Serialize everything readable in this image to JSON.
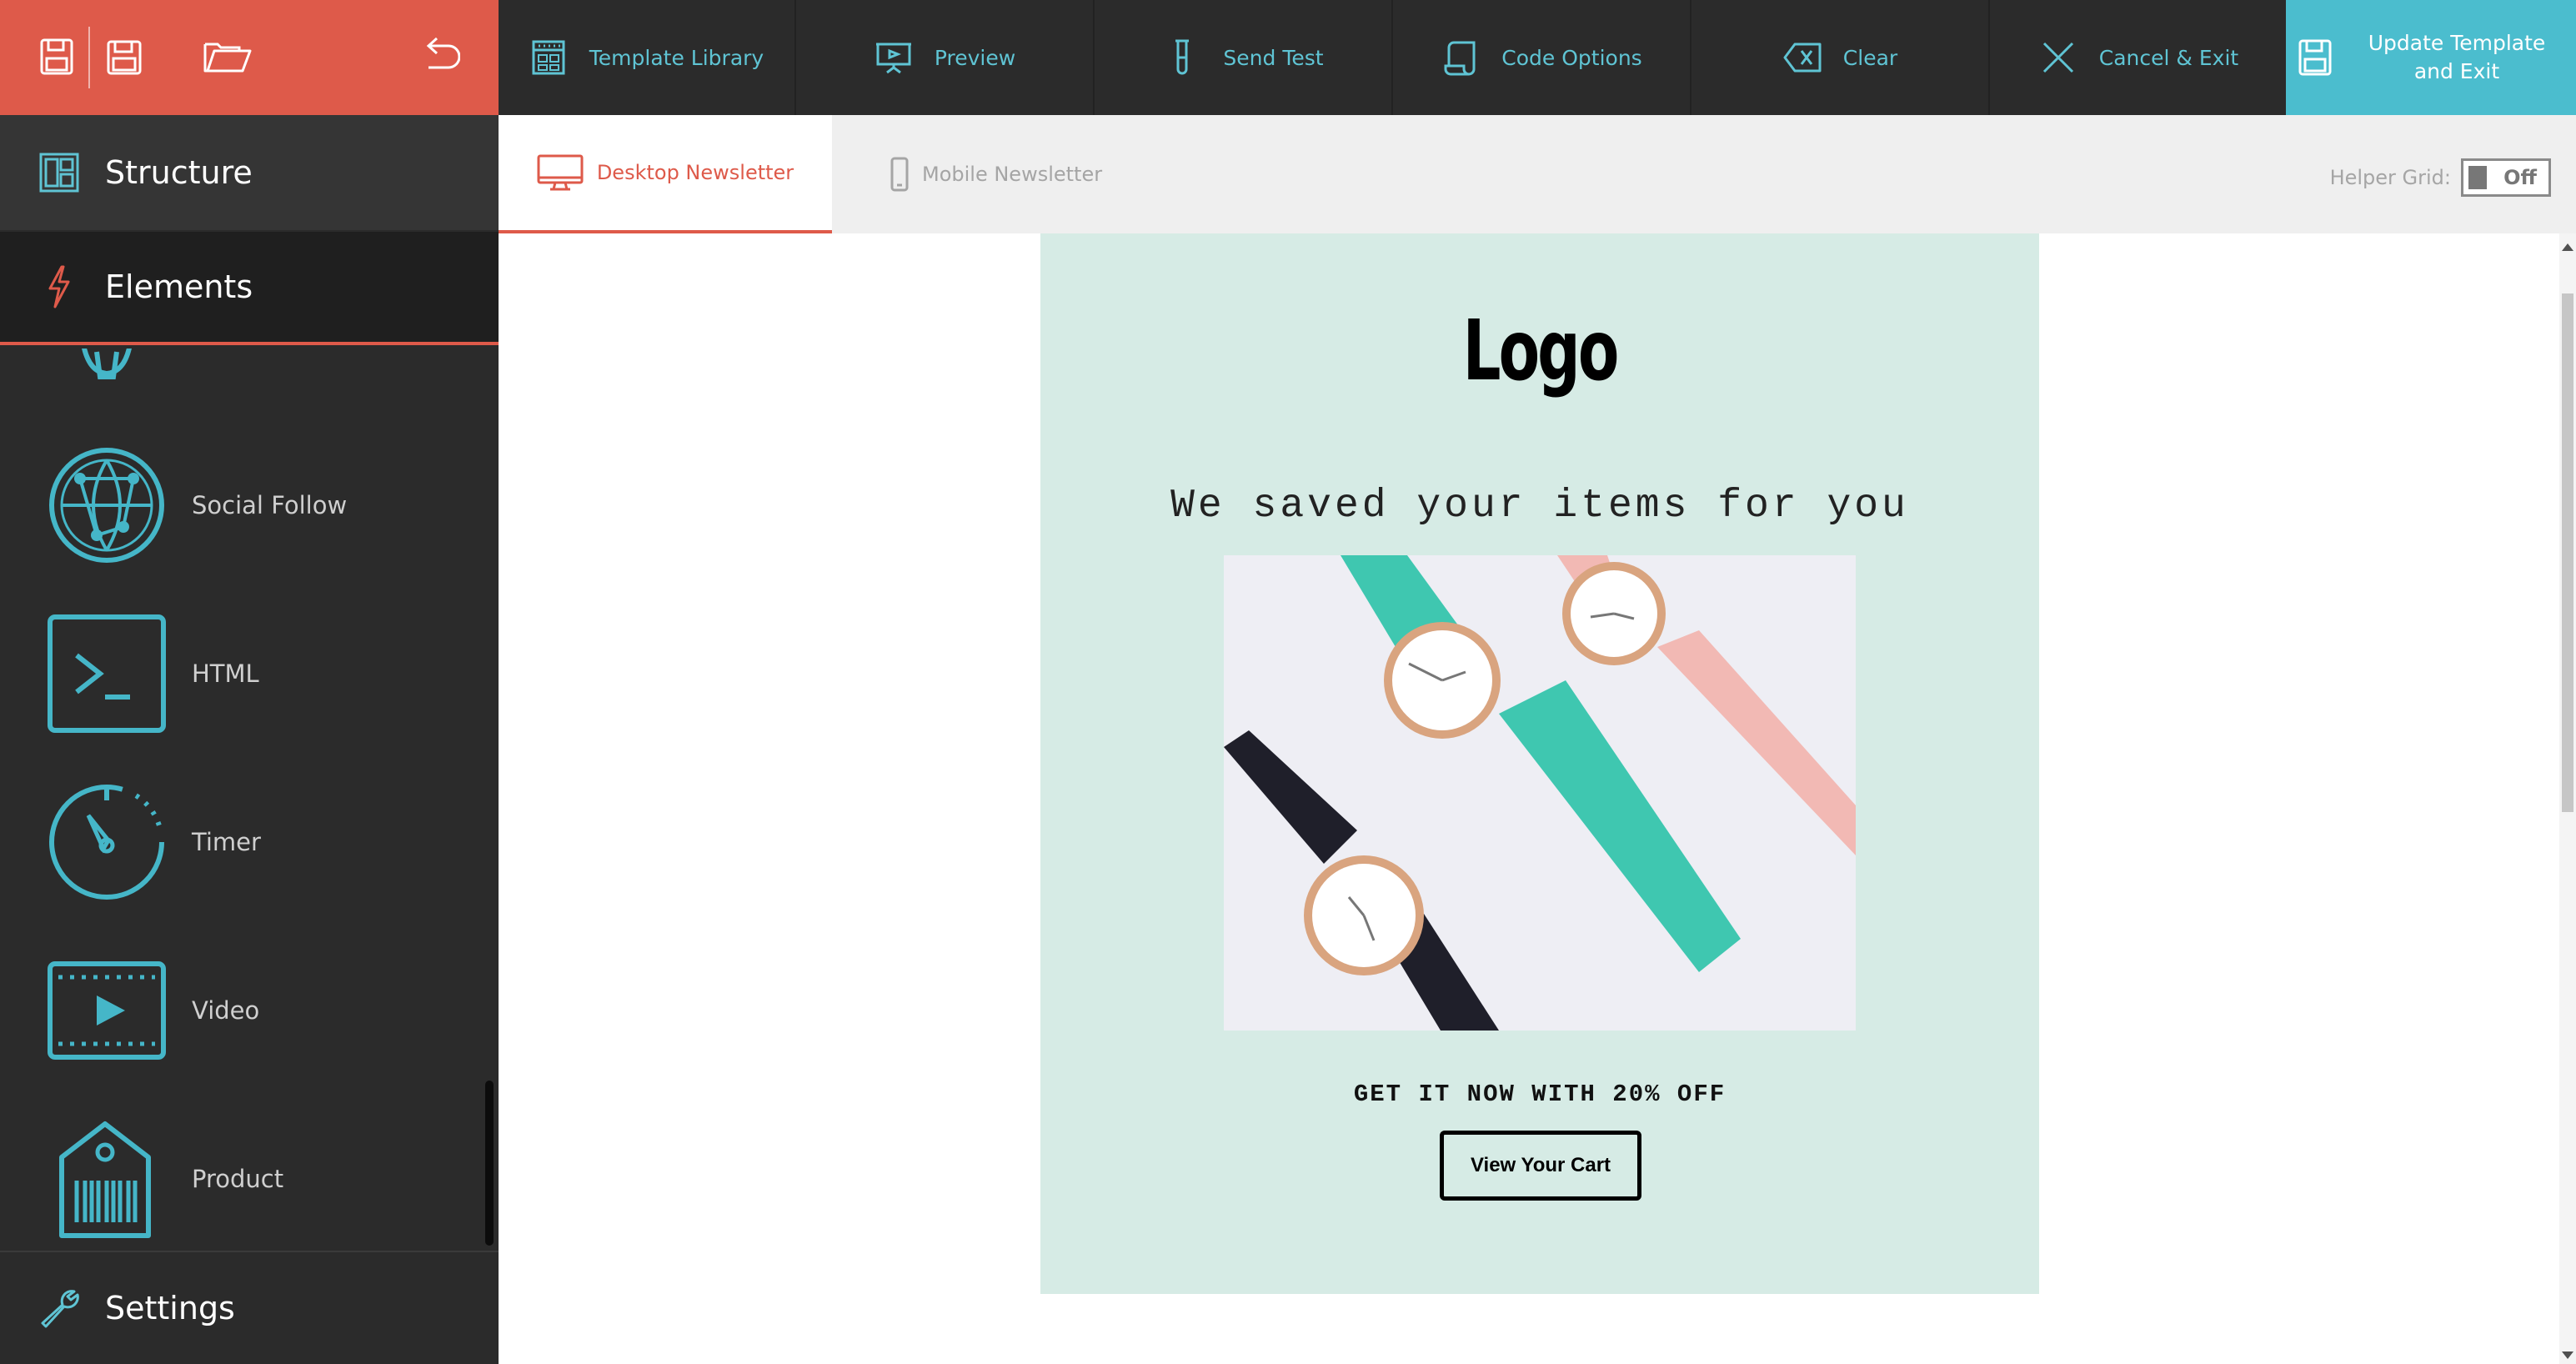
{
  "toolbar": {
    "template_library": "Template Library",
    "preview": "Preview",
    "send_test": "Send Test",
    "code_options": "Code Options",
    "clear": "Clear",
    "cancel_exit": "Cancel & Exit",
    "update_exit": "Update Template and Exit"
  },
  "sidebar": {
    "structure": "Structure",
    "elements": "Elements",
    "settings": "Settings",
    "items": [
      {
        "label": "Social Follow",
        "icon": "globe-network-icon"
      },
      {
        "label": "HTML",
        "icon": "terminal-icon"
      },
      {
        "label": "Timer",
        "icon": "timer-icon"
      },
      {
        "label": "Video",
        "icon": "video-icon"
      },
      {
        "label": "Product",
        "icon": "product-tag-icon"
      }
    ]
  },
  "tabs": {
    "desktop": "Desktop Newsletter",
    "mobile": "Mobile Newsletter",
    "active": "desktop"
  },
  "helper_grid": {
    "label": "Helper Grid:",
    "value": "Off"
  },
  "newsletter": {
    "logo": "Logo",
    "headline": "We saved your items for you",
    "offer": "GET IT NOW WITH 20% OFF",
    "cta": "View Your Cart",
    "background": "#d6ebe5"
  },
  "colors": {
    "accent": "#de5a4a",
    "teal": "#5fc4d4",
    "update_bg": "#4bbdce",
    "dark": "#2b2b2b"
  }
}
